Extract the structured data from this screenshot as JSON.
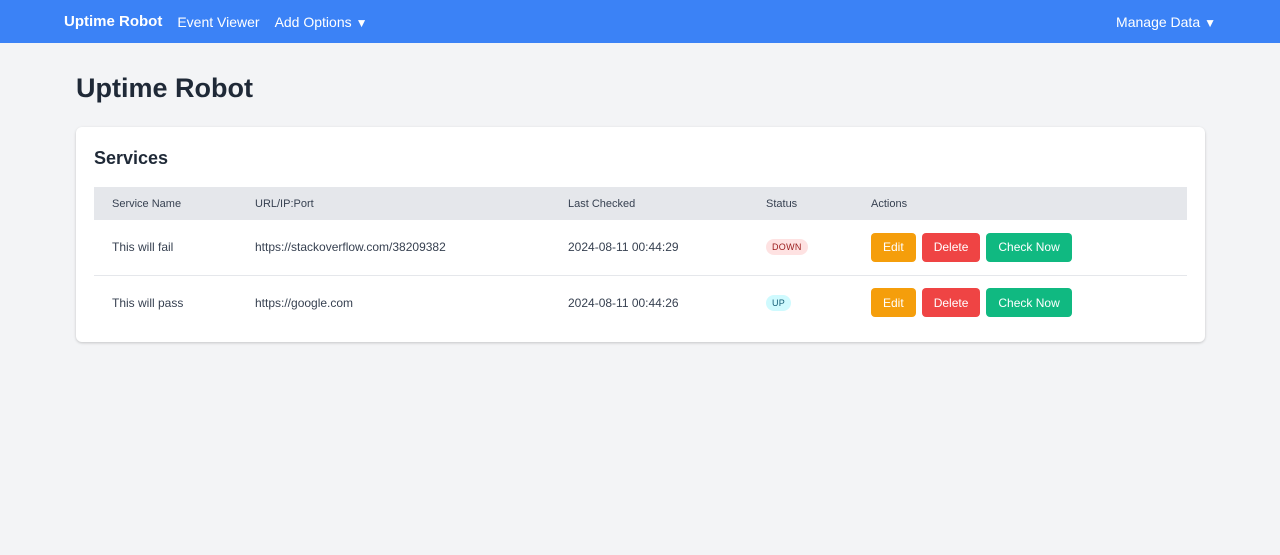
{
  "navbar": {
    "brand": "Uptime Robot",
    "event_viewer": "Event Viewer",
    "add_options": "Add Options",
    "manage_data": "Manage Data",
    "caret": "▼"
  },
  "page": {
    "title": "Uptime Robot"
  },
  "services": {
    "title": "Services",
    "columns": [
      "Service Name",
      "URL/IP:Port",
      "Last Checked",
      "Status",
      "Actions"
    ],
    "rows": [
      {
        "name": "This will fail",
        "url": "https://stackoverflow.com/38209382",
        "last_checked": "2024-08-11 00:44:29",
        "status": "DOWN"
      },
      {
        "name": "This will pass",
        "url": "https://google.com",
        "last_checked": "2024-08-11 00:44:26",
        "status": "UP"
      }
    ],
    "actions": {
      "edit": "Edit",
      "delete": "Delete",
      "check_now": "Check Now"
    }
  },
  "colors": {
    "navbar": "#3b82f6",
    "edit": "#f59e0b",
    "delete": "#ef4444",
    "check_now": "#10b981",
    "down_badge": "#fee2e2",
    "up_badge": "#cffafe"
  }
}
